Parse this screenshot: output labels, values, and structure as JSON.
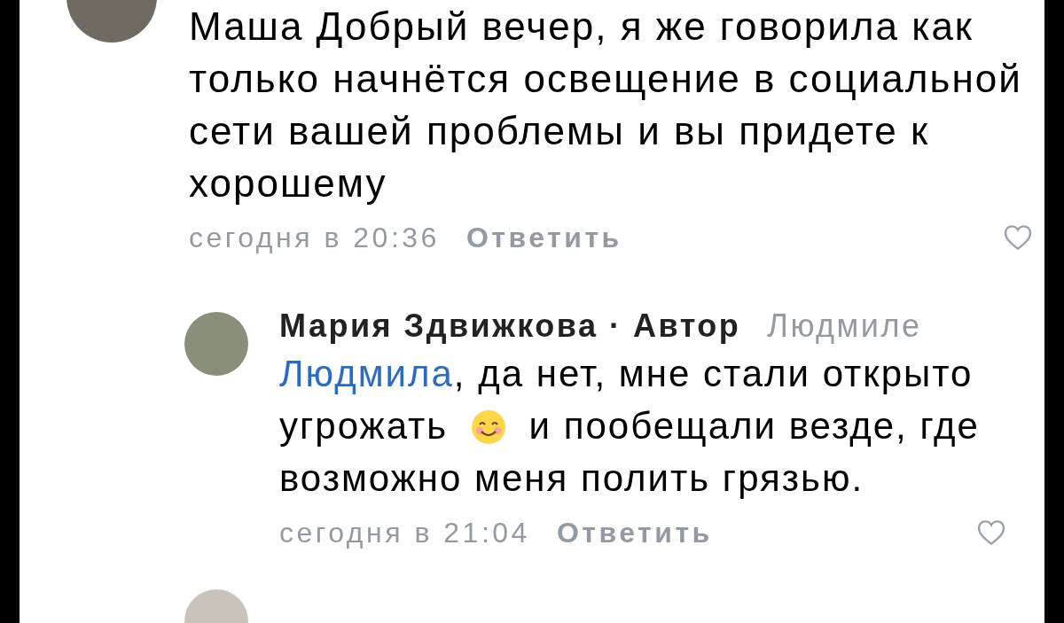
{
  "comments": [
    {
      "text": "Маша Добрый вечер, я же говорила как только начнётся освещение в социальной сети вашей проблемы и вы придете к хорошему",
      "time": "сегодня в 20:36",
      "reply_label": "Ответить",
      "liked": false,
      "replies": [
        {
          "author": "Мария Здвижкова · Автор",
          "reply_to": "Людмиле",
          "mention": "Людмила",
          "text_before_emoji": ", да нет, мне стали открыто угрожать",
          "text_after_emoji": "и пообещали везде, где возможно меня полить грязью.",
          "time": "сегодня в 21:04",
          "reply_label": "Ответить",
          "liked": false
        }
      ]
    }
  ]
}
